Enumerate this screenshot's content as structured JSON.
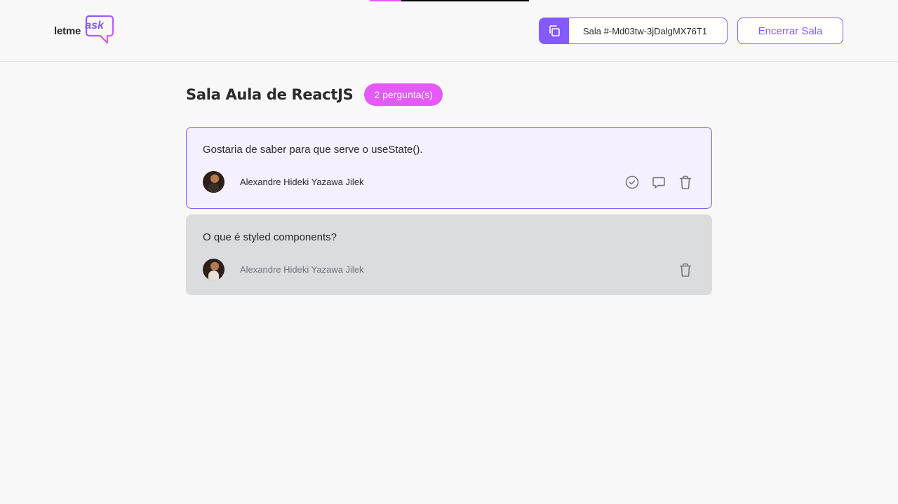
{
  "header": {
    "logo_text_left": "letme",
    "logo_text_right": "ask",
    "room_code_label": "Sala #-Md03tw-3jDalgMX76T1",
    "close_room_label": "Encerrar Sala"
  },
  "progress": {
    "fraction": 0.2
  },
  "room": {
    "title": "Sala Aula de ReactJS",
    "question_count_label": "2 pergunta(s)"
  },
  "questions": [
    {
      "text": "Gostaria de saber para que serve o useState().",
      "author": "Alexandre Hideki Yazawa Jilek",
      "state": "highlighted",
      "actions": [
        "check-icon",
        "answer-icon",
        "delete-icon"
      ]
    },
    {
      "text": "O que é styled components?",
      "author": "Alexandre Hideki Yazawa Jilek",
      "state": "answered",
      "actions": [
        "delete-icon"
      ]
    }
  ],
  "colors": {
    "accent": "#835afd",
    "badge": "#e559f9",
    "highlight_bg": "#f4f0ff",
    "answered_bg": "#dbdcdd",
    "background": "#f8f8f8",
    "icon": "#737380"
  }
}
